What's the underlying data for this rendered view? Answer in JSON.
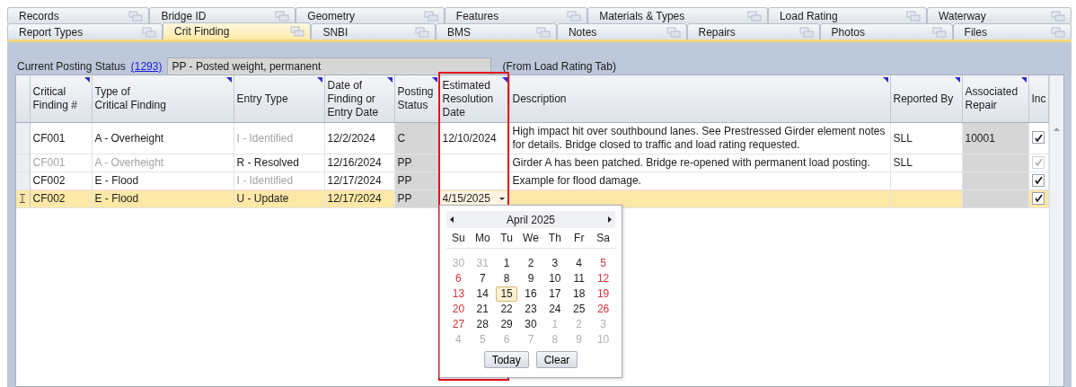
{
  "tab_rows": [
    [
      {
        "label": "Records",
        "selected": false
      },
      {
        "label": "Bridge ID",
        "selected": false
      },
      {
        "label": "Geometry",
        "selected": false
      },
      {
        "label": "Features",
        "selected": false
      },
      {
        "label": "Materials & Types",
        "selected": false
      },
      {
        "label": "Load Rating",
        "selected": false
      },
      {
        "label": "Waterway",
        "selected": false
      }
    ],
    [
      {
        "label": "Report Types",
        "selected": false
      },
      {
        "label": "Crit Finding",
        "selected": true
      },
      {
        "label": "SNBI",
        "selected": false
      },
      {
        "label": "BMS",
        "selected": false
      },
      {
        "label": "Notes",
        "selected": false
      },
      {
        "label": "Repairs",
        "selected": false
      },
      {
        "label": "Photos",
        "selected": false
      },
      {
        "label": "Files",
        "selected": false
      }
    ]
  ],
  "posting_status": {
    "label": "Current Posting Status",
    "link": "(1293)",
    "value": "PP - Posted weight, permanent",
    "note": "(From Load Rating Tab)"
  },
  "table": {
    "columns": [
      {
        "label": "Critical Finding #",
        "filter": true,
        "readonly": false,
        "highlighted": false
      },
      {
        "label": "Type of\nCritical Finding",
        "filter": true,
        "readonly": false,
        "highlighted": false
      },
      {
        "label": "Entry Type",
        "filter": true,
        "readonly": false,
        "highlighted": false
      },
      {
        "label": "Date of Finding or Entry Date",
        "filter": true,
        "readonly": false,
        "highlighted": false
      },
      {
        "label": "Posting Status",
        "filter": true,
        "readonly": true,
        "highlighted": false
      },
      {
        "label": "Estimated Resolution Date",
        "filter": true,
        "readonly": false,
        "highlighted": true
      },
      {
        "label": "Description",
        "filter": true,
        "readonly": false,
        "highlighted": false
      },
      {
        "label": "Reported By",
        "filter": true,
        "readonly": false,
        "highlighted": false
      },
      {
        "label": "Associated Repair",
        "filter": true,
        "readonly": true,
        "highlighted": false
      },
      {
        "label": "Inc",
        "filter": false,
        "readonly": false,
        "highlighted": false
      }
    ],
    "rows": [
      {
        "selected": false,
        "inc": {
          "checked": true,
          "disabled": false
        },
        "cells": [
          {
            "text": "CF001",
            "dim": false
          },
          {
            "text": "A - Overheight",
            "dim": false
          },
          {
            "text": "I - Identified",
            "dim": true
          },
          {
            "text": "12/2/2024",
            "dim": false
          },
          {
            "text": "C",
            "dim": false
          },
          {
            "text": "12/10/2024",
            "dim": false
          },
          {
            "text": "High impact hit over southbound lanes. See Prestressed Girder element notes for details. Bridge closed to traffic and load rating requested.",
            "dim": false
          },
          {
            "text": "SLL",
            "dim": false
          },
          {
            "text": "10001",
            "dim": false
          }
        ]
      },
      {
        "selected": false,
        "inc": {
          "checked": true,
          "disabled": true
        },
        "cells": [
          {
            "text": "CF001",
            "dim": true
          },
          {
            "text": "A - Overheight",
            "dim": true
          },
          {
            "text": "R - Resolved",
            "dim": false
          },
          {
            "text": "12/16/2024",
            "dim": false
          },
          {
            "text": "PP",
            "dim": false
          },
          {},
          {
            "text": "Girder A has been patched. Bridge re-opened with permanent load posting.",
            "dim": false
          },
          {
            "text": "SLL",
            "dim": false
          },
          {}
        ]
      },
      {
        "selected": false,
        "inc": {
          "checked": true,
          "disabled": false
        },
        "cells": [
          {
            "text": "CF002",
            "dim": false
          },
          {
            "text": "E - Flood",
            "dim": false
          },
          {
            "text": "I - Identified",
            "dim": true
          },
          {
            "text": "12/17/2024",
            "dim": false
          },
          {
            "text": "PP",
            "dim": false
          },
          {},
          {
            "text": "Example for flood damage.",
            "dim": false
          },
          {},
          {}
        ]
      },
      {
        "selected": true,
        "inc": {
          "checked": true,
          "disabled": false
        },
        "cells": [
          {
            "text": "CF002",
            "dim": false
          },
          {
            "text": "E - Flood",
            "dim": false
          },
          {
            "text": "U - Update",
            "dim": false
          },
          {
            "text": "12/17/2024",
            "dim": false
          },
          {
            "text": "PP",
            "dim": false
          },
          {
            "text": "4/15/2025",
            "editing": true
          },
          {},
          {},
          {}
        ]
      }
    ]
  },
  "calendar": {
    "month": "April 2025",
    "weekdays": [
      "Su",
      "Mo",
      "Tu",
      "We",
      "Th",
      "Fr",
      "Sa"
    ],
    "weeks": [
      [
        {
          "day": "30",
          "kind": "other",
          "selected": false
        },
        {
          "day": "31",
          "kind": "other",
          "selected": false
        },
        {
          "day": "1",
          "kind": "weekday",
          "selected": false
        },
        {
          "day": "2",
          "kind": "weekday",
          "selected": false
        },
        {
          "day": "3",
          "kind": "weekday",
          "selected": false
        },
        {
          "day": "4",
          "kind": "weekday",
          "selected": false
        },
        {
          "day": "5",
          "kind": "weekend",
          "selected": false
        }
      ],
      [
        {
          "day": "6",
          "kind": "weekend",
          "selected": false
        },
        {
          "day": "7",
          "kind": "weekday",
          "selected": false
        },
        {
          "day": "8",
          "kind": "weekday",
          "selected": false
        },
        {
          "day": "9",
          "kind": "weekday",
          "selected": false
        },
        {
          "day": "10",
          "kind": "weekday",
          "selected": false
        },
        {
          "day": "11",
          "kind": "weekday",
          "selected": false
        },
        {
          "day": "12",
          "kind": "weekend",
          "selected": false
        }
      ],
      [
        {
          "day": "13",
          "kind": "weekend",
          "selected": false
        },
        {
          "day": "14",
          "kind": "weekday",
          "selected": false
        },
        {
          "day": "15",
          "kind": "weekday",
          "selected": true
        },
        {
          "day": "16",
          "kind": "weekday",
          "selected": false
        },
        {
          "day": "17",
          "kind": "weekday",
          "selected": false
        },
        {
          "day": "18",
          "kind": "weekday",
          "selected": false
        },
        {
          "day": "19",
          "kind": "weekend",
          "selected": false
        }
      ],
      [
        {
          "day": "20",
          "kind": "weekend",
          "selected": false
        },
        {
          "day": "21",
          "kind": "weekday",
          "selected": false
        },
        {
          "day": "22",
          "kind": "weekday",
          "selected": false
        },
        {
          "day": "23",
          "kind": "weekday",
          "selected": false
        },
        {
          "day": "24",
          "kind": "weekday",
          "selected": false
        },
        {
          "day": "25",
          "kind": "weekday",
          "selected": false
        },
        {
          "day": "26",
          "kind": "weekend",
          "selected": false
        }
      ],
      [
        {
          "day": "27",
          "kind": "weekend",
          "selected": false
        },
        {
          "day": "28",
          "kind": "weekday",
          "selected": false
        },
        {
          "day": "29",
          "kind": "weekday",
          "selected": false
        },
        {
          "day": "30",
          "kind": "weekday",
          "selected": false
        },
        {
          "day": "1",
          "kind": "other",
          "selected": false
        },
        {
          "day": "2",
          "kind": "other",
          "selected": false
        },
        {
          "day": "3",
          "kind": "other",
          "selected": false
        }
      ],
      [
        {
          "day": "4",
          "kind": "other",
          "selected": false
        },
        {
          "day": "5",
          "kind": "other",
          "selected": false
        },
        {
          "day": "6",
          "kind": "other",
          "selected": false
        },
        {
          "day": "7",
          "kind": "other",
          "selected": false
        },
        {
          "day": "8",
          "kind": "other",
          "selected": false
        },
        {
          "day": "9",
          "kind": "other",
          "selected": false
        },
        {
          "day": "10",
          "kind": "other",
          "selected": false
        }
      ]
    ],
    "buttons": [
      "Today",
      "Clear"
    ]
  }
}
